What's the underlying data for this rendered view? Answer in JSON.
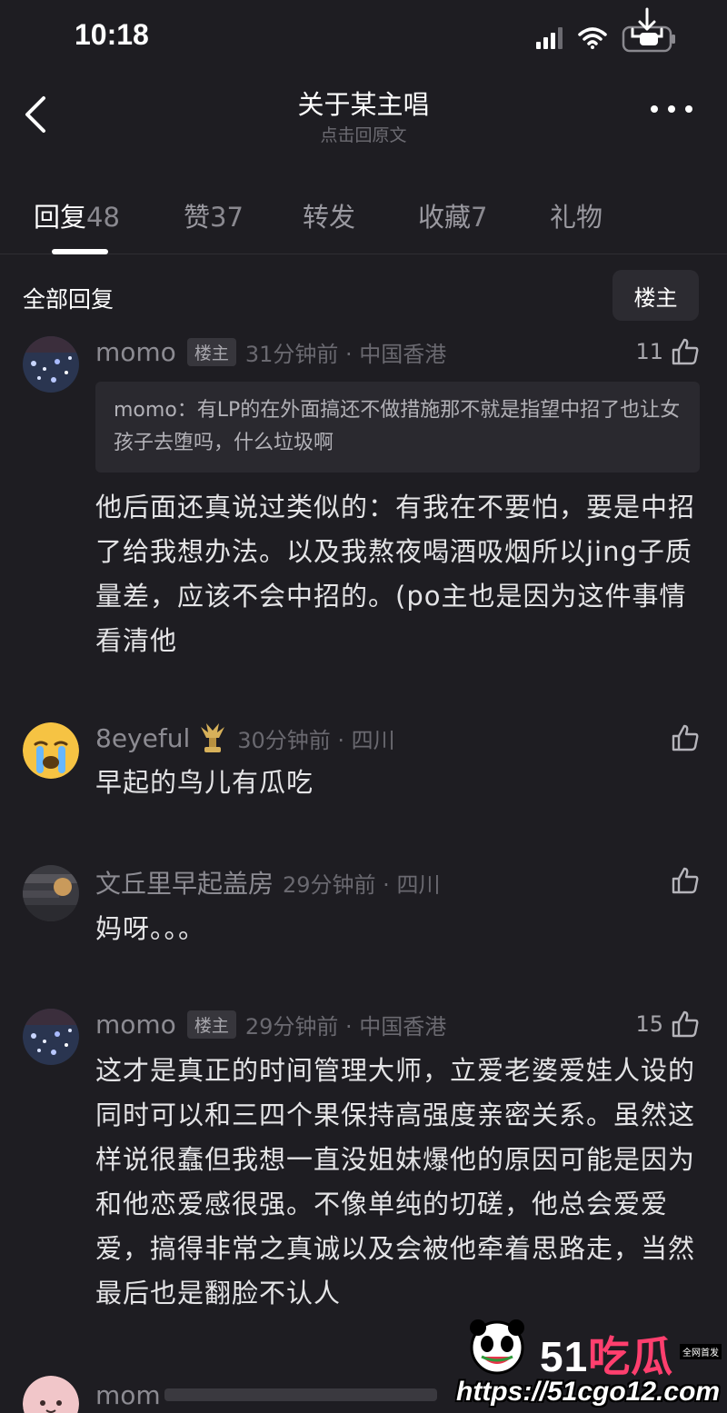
{
  "status": {
    "time": "10:18"
  },
  "nav": {
    "title": "关于某主唱",
    "subtitle": "点击回原文"
  },
  "tabs": [
    {
      "label": "回复",
      "count": "48"
    },
    {
      "label": "赞",
      "count": "37"
    },
    {
      "label": "转发",
      "count": ""
    },
    {
      "label": "收藏",
      "count": "7"
    },
    {
      "label": "礼物",
      "count": ""
    }
  ],
  "section": {
    "title": "全部回复",
    "filter_label": "楼主"
  },
  "comments": [
    {
      "name": "momo",
      "badge": "楼主",
      "meta": "31分钟前 · 中国香港",
      "likes": "11",
      "quote": "momo：有LP的在外面搞还不做措施那不就是指望中招了也让女孩子去堕吗，什么垃圾啊",
      "text": "他后面还真说过类似的：有我在不要怕，要是中招了给我想办法。以及我熬夜喝酒吸烟所以jing子质量差，应该不会中招的。(po主也是因为这件事情看清他"
    },
    {
      "name": "8eyeful",
      "meta": "30分钟前 · 四川",
      "likes": "",
      "text": "早起的鸟儿有瓜吃"
    },
    {
      "name": "文丘里早起盖房",
      "meta": "29分钟前 · 四川",
      "likes": "",
      "text": "妈呀。。。"
    },
    {
      "name": "momo",
      "badge": "楼主",
      "meta": "29分钟前 · 中国香港",
      "likes": "15",
      "text": "这才是真正的时间管理大师，立爱老婆爱娃人设的同时可以和三四个果保持高强度亲密关系。虽然这样说很蠢但我想一直没姐妹爆他的原因可能是因为和他恋爱感很强。不像单纯的切磋，他总会爱爱爱，搞得非常之真诚以及会被他牵着思路走，当然最后也是翻脸不认人"
    },
    {
      "name": "mom"
    }
  ],
  "watermark": {
    "logo_num": "51",
    "logo_cn": "吃瓜",
    "tag": "全网首发",
    "url": "https://51cgo12.com"
  }
}
